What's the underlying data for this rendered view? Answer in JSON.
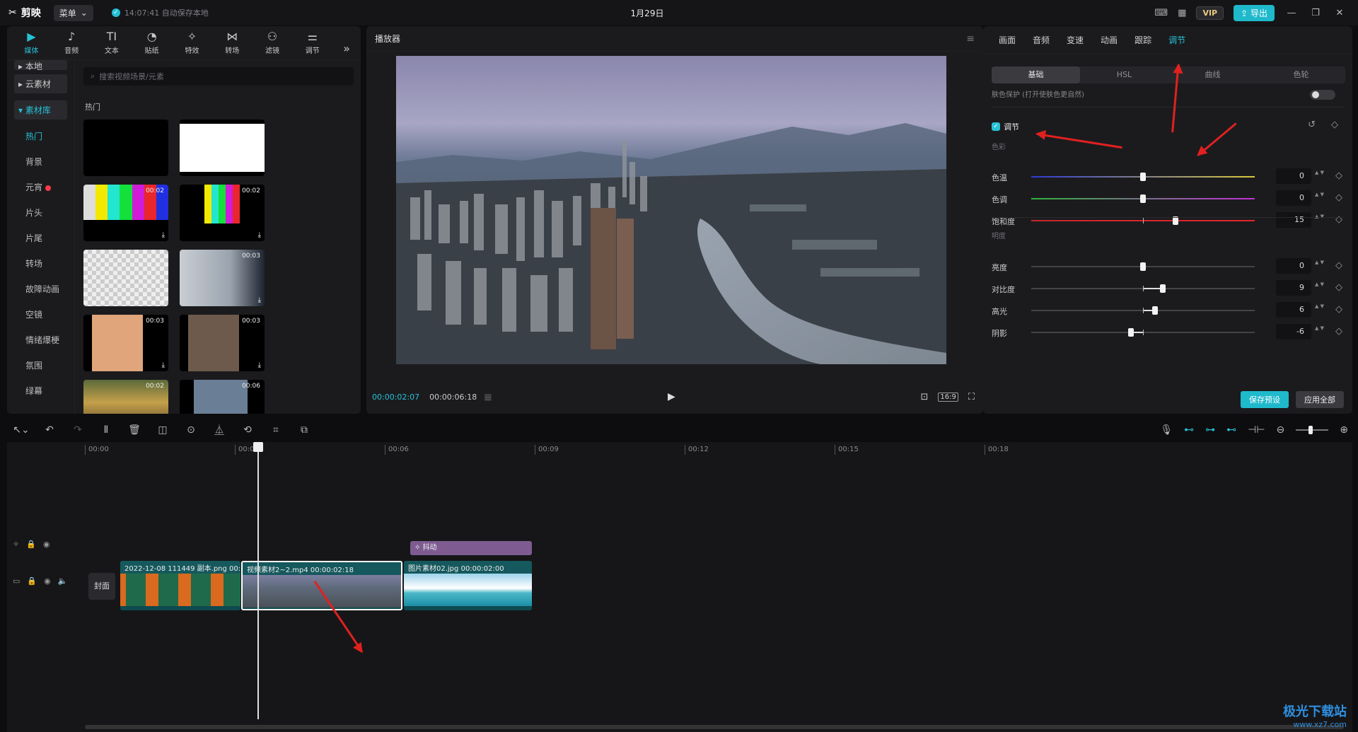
{
  "titlebar": {
    "app_name": "剪映",
    "menu_label": "菜单",
    "autosave": "14:07:41 自动保存本地",
    "project_title": "1月29日",
    "vip_label": "VIP",
    "export_label": "导出"
  },
  "media_tabs": [
    {
      "label": "媒体",
      "icon": "media-icon",
      "glyph": "▶"
    },
    {
      "label": "音频",
      "icon": "audio-icon",
      "glyph": "♪"
    },
    {
      "label": "文本",
      "icon": "text-icon",
      "glyph": "TI"
    },
    {
      "label": "贴纸",
      "icon": "sticker-icon",
      "glyph": "◔"
    },
    {
      "label": "特效",
      "icon": "effects-icon",
      "glyph": "✧"
    },
    {
      "label": "转场",
      "icon": "transition-icon",
      "glyph": "⋈"
    },
    {
      "label": "滤镜",
      "icon": "filter-icon",
      "glyph": "⚇"
    },
    {
      "label": "调节",
      "icon": "adjust-icon",
      "glyph": "⚌"
    }
  ],
  "media_sidebar": {
    "local": "本地",
    "cloud": "云素材",
    "library": "素材库",
    "items": [
      "热门",
      "背景",
      "元宵",
      "片头",
      "片尾",
      "转场",
      "故障动画",
      "空镜",
      "情绪爆梗",
      "氛围",
      "绿幕"
    ]
  },
  "media_search_placeholder": "搜索视频场景/元素",
  "media_section": "热门",
  "thumbs": [
    {
      "duration": "",
      "kind": "black"
    },
    {
      "duration": "",
      "kind": "white"
    },
    {
      "duration": "00:02",
      "kind": "bars1"
    },
    {
      "duration": "00:02",
      "kind": "bars2"
    },
    {
      "duration": "",
      "kind": "transparent"
    },
    {
      "duration": "00:03",
      "kind": "man"
    },
    {
      "duration": "00:03",
      "kind": "woman"
    },
    {
      "duration": "00:03",
      "kind": "laugh"
    },
    {
      "duration": "00:02",
      "kind": "crowd"
    },
    {
      "duration": "00:06",
      "kind": "landscape"
    }
  ],
  "player": {
    "title": "播放器",
    "current_time": "00:00:02:07",
    "total_time": "00:00:06:18",
    "ratio": "16:9"
  },
  "props_tabs": [
    "画面",
    "音频",
    "变速",
    "动画",
    "跟踪",
    "调节"
  ],
  "props_active_tab": "调节",
  "sub_tabs": [
    "基础",
    "HSL",
    "曲线",
    "色轮"
  ],
  "skin_protect": "肤色保护    (打开使肤色更自然)",
  "adjust_label": "调节",
  "color_group": "色彩",
  "light_group": "明度",
  "sliders_color": [
    {
      "label": "色温",
      "value": "0",
      "pos": 0.5,
      "style": "temp"
    },
    {
      "label": "色调",
      "value": "0",
      "pos": 0.5,
      "style": "tint"
    },
    {
      "label": "饱和度",
      "value": "15",
      "pos": 0.645,
      "style": "sat"
    }
  ],
  "sliders_light": [
    {
      "label": "亮度",
      "value": "0",
      "pos": 0.5
    },
    {
      "label": "对比度",
      "value": "9",
      "pos": 0.59
    },
    {
      "label": "高光",
      "value": "6",
      "pos": 0.555
    },
    {
      "label": "阴影",
      "value": "-6",
      "pos": 0.445
    }
  ],
  "buttons": {
    "save_preset": "保存预设",
    "apply_all": "应用全部"
  },
  "ruler": [
    "00:00",
    "00:03",
    "00:06",
    "00:09",
    "00:12",
    "00:15",
    "00:18"
  ],
  "timeline": {
    "cover_label": "封面",
    "effect_clip": "抖动",
    "clips": [
      {
        "name": "2022-12-08 111449 副本.png",
        "time": "00:0"
      },
      {
        "name": "视频素材2~2.mp4",
        "time": "00:00:02:18"
      },
      {
        "name": "图片素材02.jpg",
        "time": "00:00:02:00"
      }
    ]
  },
  "watermark": {
    "main": "极光下载站",
    "sub": "www.xz7.com"
  }
}
